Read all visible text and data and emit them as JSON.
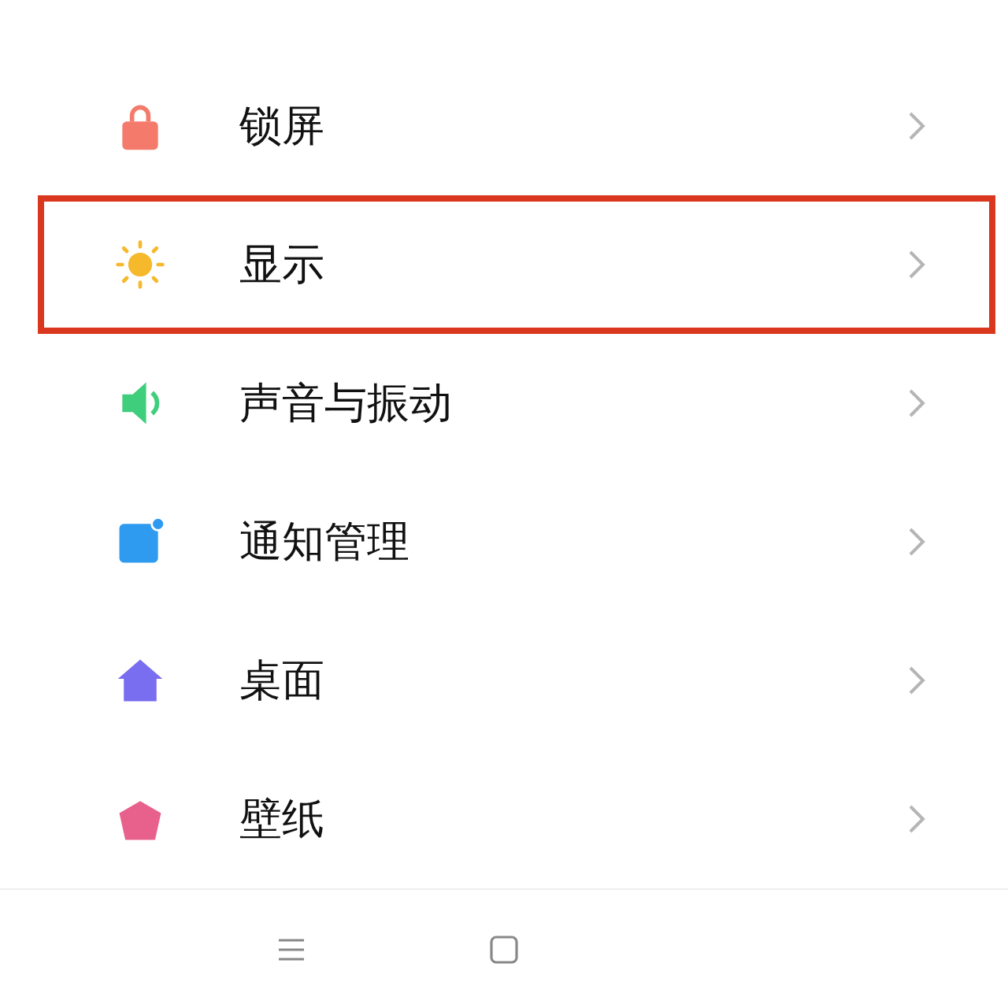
{
  "settings": [
    {
      "label": "锁屏",
      "color": "#f47b6b",
      "highlighted": false
    },
    {
      "label": "显示",
      "color": "#f5b92b",
      "highlighted": true
    },
    {
      "label": "声音与振动",
      "color": "#3fce7c",
      "highlighted": false
    },
    {
      "label": "通知管理",
      "color": "#2f9bf0",
      "highlighted": false
    },
    {
      "label": "桌面",
      "color": "#7a6ef0",
      "highlighted": false
    },
    {
      "label": "壁纸",
      "color": "#e8608c",
      "highlighted": false
    }
  ]
}
